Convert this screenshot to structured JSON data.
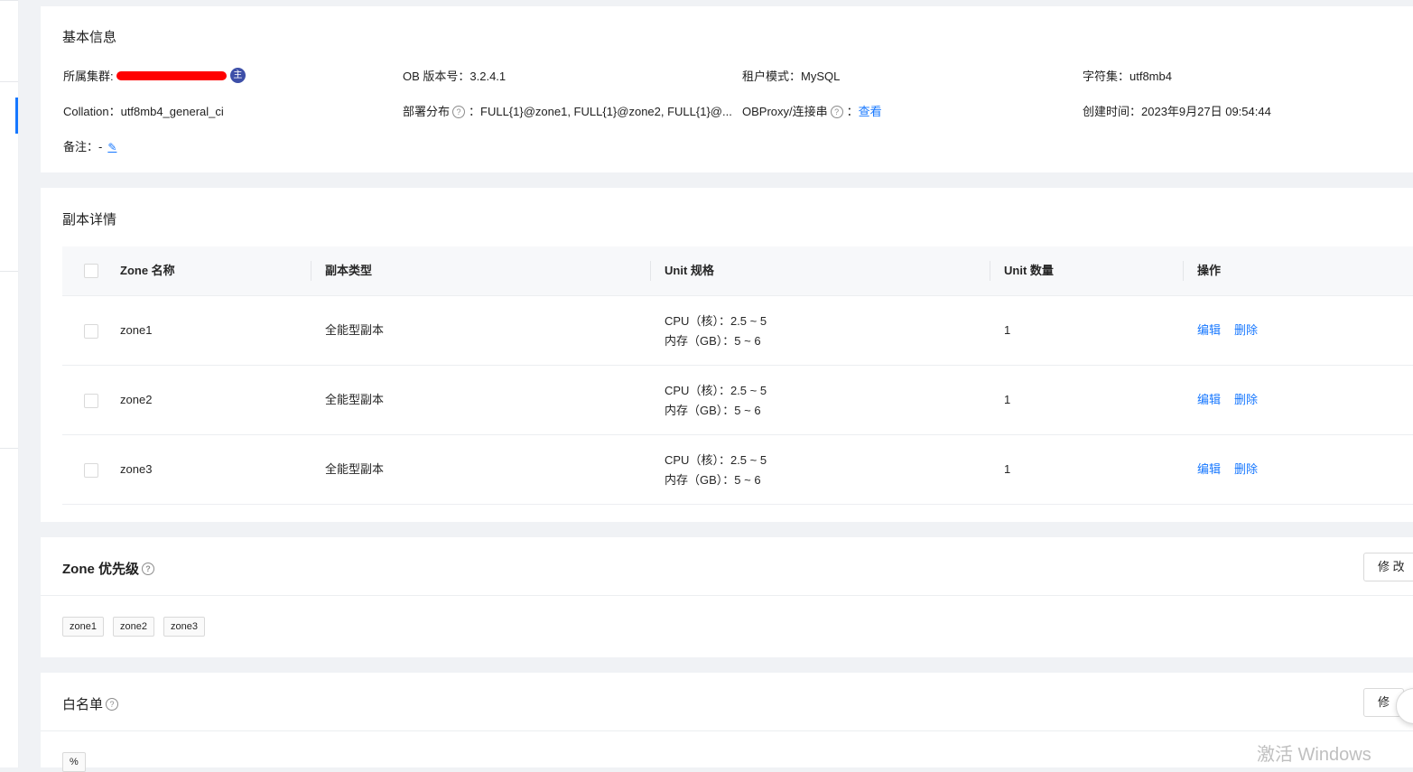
{
  "basic_info": {
    "title": "基本信息",
    "cluster_label": "所属集群:",
    "cluster_badge": "主",
    "ob_version": "OB 版本号：3.2.4.1",
    "tenant_mode": "租户模式：MySQL",
    "charset": "字符集：utf8mb4",
    "collation": "Collation：utf8mb4_general_ci",
    "deploy_label": "部署分布",
    "deploy_value": "：FULL{1}@zone1, FULL{1}@zone2, FULL{1}@...",
    "obproxy_label": "OBProxy/连接串",
    "obproxy_sep": "：",
    "obproxy_link": "查看",
    "created_time": "创建时间：2023年9月27日 09:54:44",
    "remark": "备注：-"
  },
  "replica": {
    "title": "副本详情",
    "columns": [
      "Zone 名称",
      "副本类型",
      "Unit 规格",
      "Unit 数量",
      "操作"
    ],
    "rows": [
      {
        "zone": "zone1",
        "type": "全能型副本",
        "cpu": "CPU（核）：2.5 ~ 5",
        "mem": "内存（GB）：5 ~ 6",
        "count": "1",
        "edit": "编辑",
        "delete": "删除"
      },
      {
        "zone": "zone2",
        "type": "全能型副本",
        "cpu": "CPU（核）：2.5 ~ 5",
        "mem": "内存（GB）：5 ~ 6",
        "count": "1",
        "edit": "编辑",
        "delete": "删除"
      },
      {
        "zone": "zone3",
        "type": "全能型副本",
        "cpu": "CPU（核）：2.5 ~ 5",
        "mem": "内存（GB）：5 ~ 6",
        "count": "1",
        "edit": "编辑",
        "delete": "删除"
      }
    ]
  },
  "zone_priority": {
    "title": "Zone 优先级",
    "modify_button": "修 改",
    "tags": [
      "zone1",
      "zone2",
      "zone3"
    ]
  },
  "whitelist": {
    "title": "白名单",
    "modify_button": "修",
    "tags": [
      "%"
    ]
  },
  "watermark": "激活 Windows",
  "icons": {
    "help": "question-circle-icon",
    "edit": "edit-icon",
    "float": "history-icon"
  },
  "colors": {
    "link": "#1677ff",
    "redaction": "#ff0000",
    "badge": "#3d4fa8"
  }
}
